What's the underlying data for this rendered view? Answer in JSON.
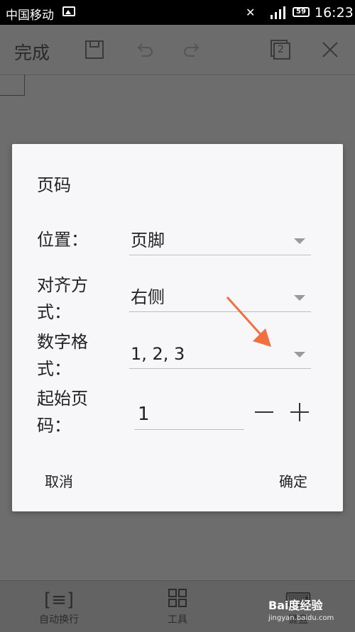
{
  "status_bar": {
    "carrier": "中国移动",
    "battery": "59",
    "time": "16:23"
  },
  "toolbar": {
    "done_label": "完成",
    "icons": [
      "save-icon",
      "undo-icon",
      "redo-icon",
      "pages-icon",
      "close-icon"
    ],
    "pages_count": "2"
  },
  "dialog": {
    "title": "页码",
    "rows": [
      {
        "label": "位置：",
        "value": "页脚"
      },
      {
        "label": "对齐方式：",
        "value": "右侧"
      },
      {
        "label": "数字格式：",
        "value": "1, 2, 3"
      }
    ],
    "start_label": "起始页码：",
    "start_value": "1",
    "cancel_label": "取消",
    "ok_label": "确定"
  },
  "bottom_bar": {
    "items": [
      {
        "label": "自动换行",
        "icon": "wrap-icon"
      },
      {
        "label": "工具",
        "icon": "grid-icon"
      },
      {
        "label": "键盘",
        "icon": "keyboard-icon"
      }
    ]
  },
  "watermark": {
    "text": "Bai度经验",
    "url": "jingyan.baidu.com"
  },
  "colors": {
    "arrow": "#f07040",
    "dialog_bg": "#f7f6f8",
    "overlay": "#707070"
  }
}
